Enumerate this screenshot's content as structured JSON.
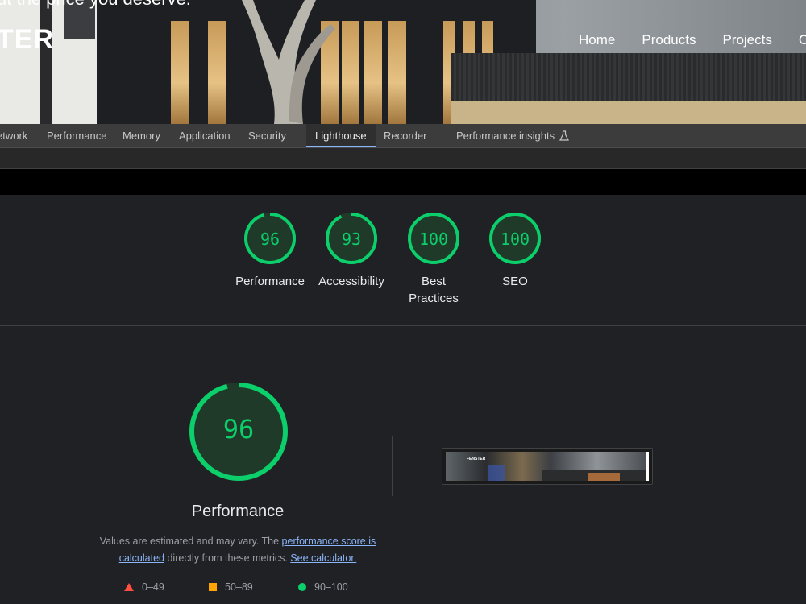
{
  "website": {
    "tagline": "ut the price you deserve.",
    "logo": "TER",
    "nav": [
      "Home",
      "Products",
      "Projects",
      "C"
    ]
  },
  "devtools_tabs": {
    "items": [
      "etwork",
      "Performance",
      "Memory",
      "Application",
      "Security",
      "Lighthouse",
      "Recorder",
      "Performance insights"
    ],
    "active": "Lighthouse"
  },
  "scores": [
    {
      "label": "Performance",
      "value": "96",
      "fraction": 0.96
    },
    {
      "label": "Accessibility",
      "value": "93",
      "fraction": 0.93
    },
    {
      "label": "Best Practices",
      "value": "100",
      "fraction": 1.0
    },
    {
      "label": "SEO",
      "value": "100",
      "fraction": 1.0
    }
  ],
  "performance": {
    "score": "96",
    "score_fraction": 0.96,
    "title": "Performance",
    "desc_pre": "Values are estimated and may vary. The ",
    "desc_link1": "performance score is calculated",
    "desc_mid": " directly from these metrics. ",
    "desc_link2": "See calculator.",
    "thumbnail_logo": "FENSTER"
  },
  "legend": {
    "fail": "0–49",
    "average": "50–89",
    "pass": "90–100"
  },
  "colors": {
    "pass": "#0cce6b",
    "average": "#ffa400",
    "fail": "#ff4e42",
    "link": "#8ab4f8"
  }
}
